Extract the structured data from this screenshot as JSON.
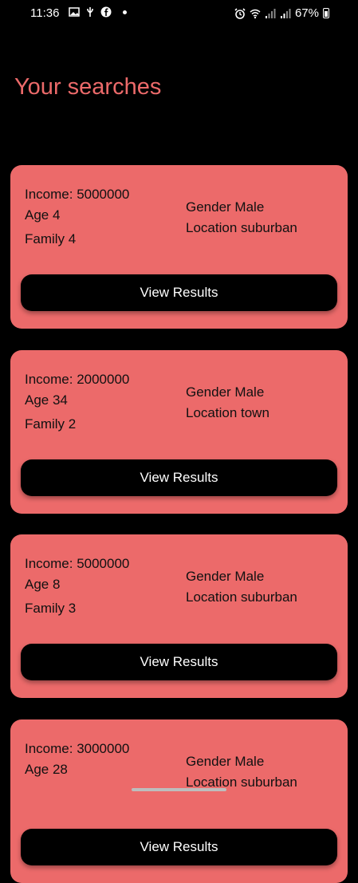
{
  "status_bar": {
    "time": "11:36",
    "battery": "67%",
    "left_icons": [
      "image-icon",
      "usb-icon",
      "facebook-icon",
      "notification-dot"
    ],
    "right_icons": [
      "alarm-icon",
      "wifi-icon",
      "signal-icon",
      "signal-icon",
      "battery-icon"
    ]
  },
  "page": {
    "title": "Your searches",
    "accent": "#ec6a6a"
  },
  "searches": [
    {
      "income": "Income: 5000000",
      "age": "Age 4",
      "family": "Family 4",
      "gender": "Gender Male",
      "location": "Location suburban",
      "button": "View Results"
    },
    {
      "income": "Income: 2000000",
      "age": "Age 34",
      "family": "Family 2",
      "gender": "Gender Male",
      "location": "Location town",
      "button": "View Results"
    },
    {
      "income": "Income: 5000000",
      "age": "Age 8",
      "family": "Family 3",
      "gender": "Gender Male",
      "location": "Location suburban",
      "button": "View Results"
    },
    {
      "income": "Income: 3000000",
      "age": "Age 28",
      "family": "",
      "gender": "Gender Male",
      "location": "Location suburban",
      "button": "View Results"
    }
  ]
}
